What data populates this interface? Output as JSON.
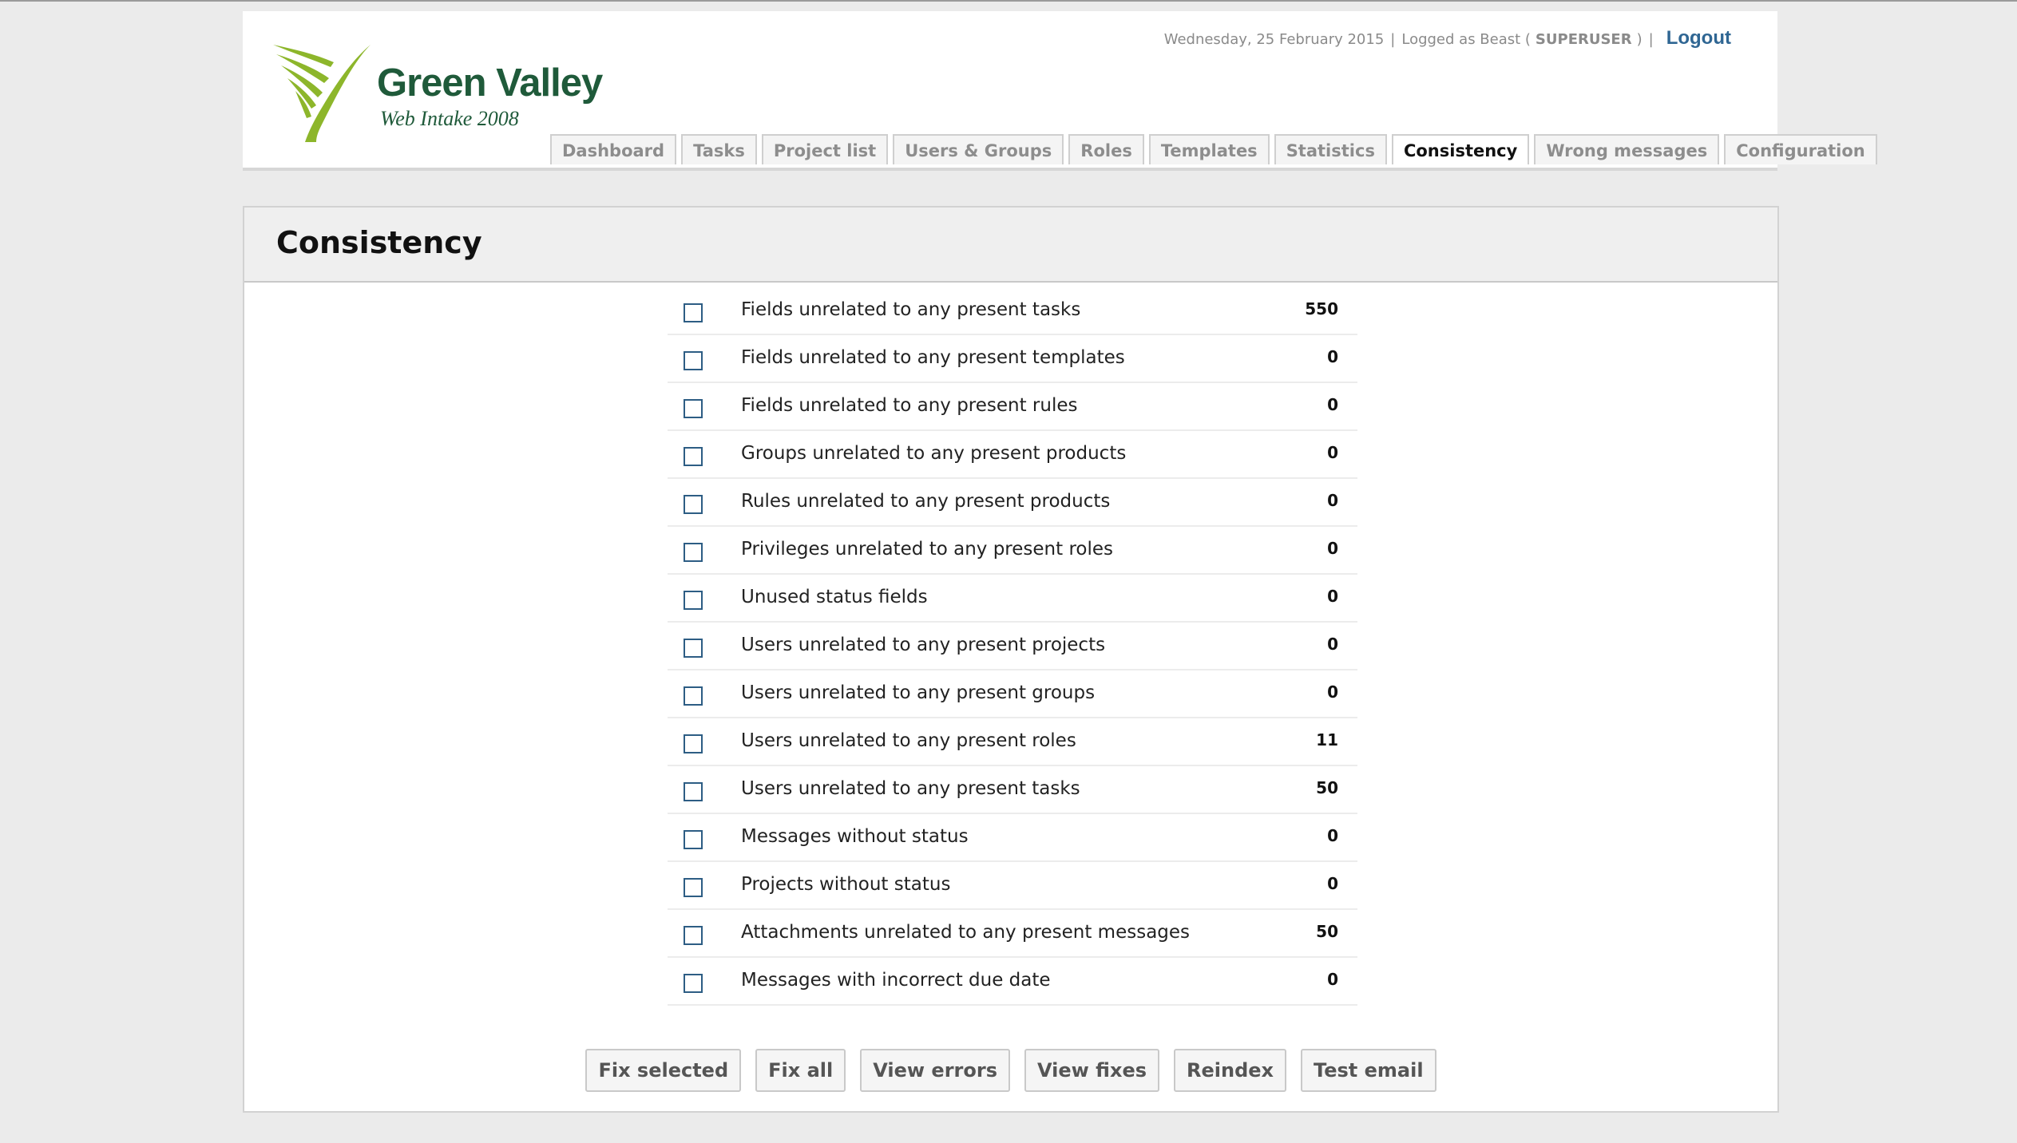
{
  "header": {
    "logo": {
      "title": "Green Valley",
      "subtitle": "Web Intake 2008",
      "colors": {
        "green": "#8db62b",
        "text": "#1f5a3a"
      }
    },
    "userbar": {
      "date": "Wednesday, 25 February 2015",
      "sep1": "|",
      "logged_prefix": "Logged as Beast (",
      "role": "SUPERUSER",
      "logged_suffix": ")",
      "sep2": "|",
      "logout": "Logout"
    },
    "tabs": [
      {
        "label": "Dashboard",
        "active": false
      },
      {
        "label": "Tasks",
        "active": false
      },
      {
        "label": "Project list",
        "active": false
      },
      {
        "label": "Users & Groups",
        "active": false
      },
      {
        "label": "Roles",
        "active": false
      },
      {
        "label": "Templates",
        "active": false
      },
      {
        "label": "Statistics",
        "active": false
      },
      {
        "label": "Consistency",
        "active": true
      },
      {
        "label": "Wrong messages",
        "active": false
      },
      {
        "label": "Configuration",
        "active": false
      }
    ]
  },
  "panel": {
    "title": "Consistency",
    "checks": [
      {
        "label": "Fields unrelated to any present tasks",
        "count": "550",
        "checked": false
      },
      {
        "label": "Fields unrelated to any present templates",
        "count": "0",
        "checked": false
      },
      {
        "label": "Fields unrelated to any present rules",
        "count": "0",
        "checked": false
      },
      {
        "label": "Groups unrelated to any present products",
        "count": "0",
        "checked": false
      },
      {
        "label": "Rules unrelated to any present products",
        "count": "0",
        "checked": false
      },
      {
        "label": "Privileges unrelated to any present roles",
        "count": "0",
        "checked": false
      },
      {
        "label": "Unused status fields",
        "count": "0",
        "checked": false
      },
      {
        "label": "Users unrelated to any present projects",
        "count": "0",
        "checked": false
      },
      {
        "label": "Users unrelated to any present groups",
        "count": "0",
        "checked": false
      },
      {
        "label": "Users unrelated to any present roles",
        "count": "11",
        "checked": false
      },
      {
        "label": "Users unrelated to any present tasks",
        "count": "50",
        "checked": false
      },
      {
        "label": "Messages without status",
        "count": "0",
        "checked": false
      },
      {
        "label": "Projects without status",
        "count": "0",
        "checked": false
      },
      {
        "label": "Attachments unrelated to any present messages",
        "count": "50",
        "checked": false
      },
      {
        "label": "Messages with incorrect due date",
        "count": "0",
        "checked": false
      }
    ],
    "buttons": {
      "fix_selected": "Fix selected",
      "fix_all": "Fix all",
      "view_errors": "View errors",
      "view_fixes": "View fixes",
      "reindex": "Reindex",
      "test_email": "Test email"
    }
  },
  "colors": {
    "background": "#ebebeb",
    "link": "#2f6693",
    "checkbox_border": "#2d5d84"
  }
}
